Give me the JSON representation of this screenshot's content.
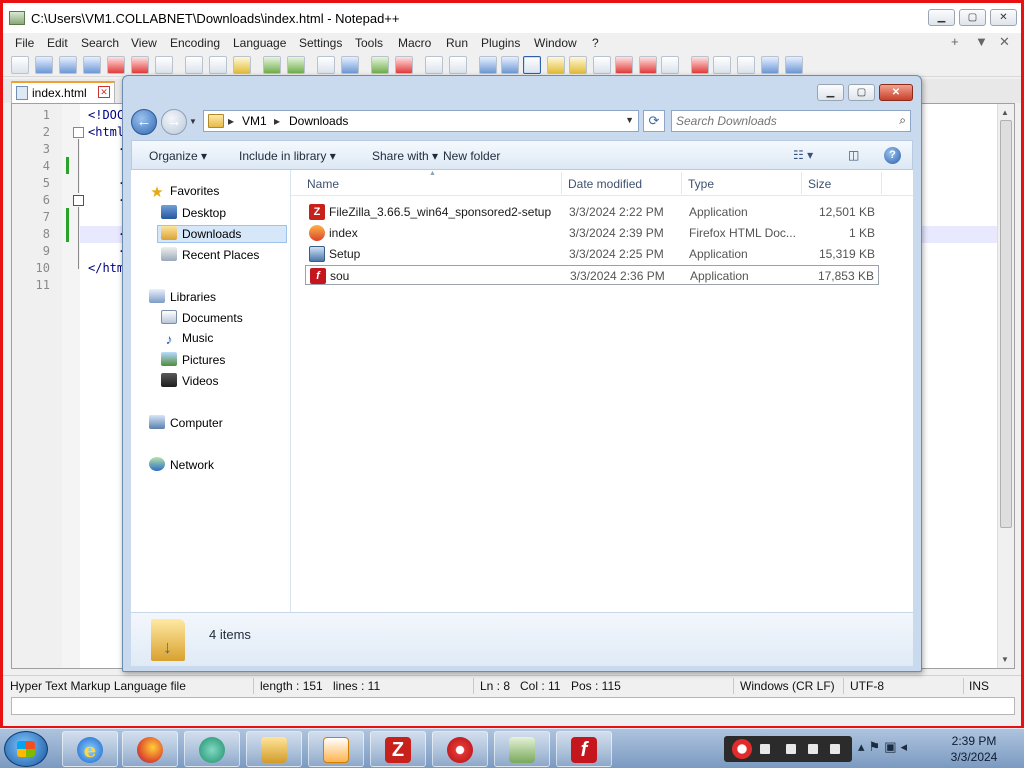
{
  "notepad": {
    "title": "C:\\Users\\VM1.COLLABNET\\Downloads\\index.html - Notepad++",
    "menu": [
      "File",
      "Edit",
      "Search",
      "View",
      "Encoding",
      "Language",
      "Settings",
      "Tools",
      "Macro",
      "Run",
      "Plugins",
      "Window",
      "?"
    ],
    "menu_right": [
      "+",
      "▼",
      "✕"
    ],
    "tab_label": "index.html",
    "line_numbers": [
      "1",
      "2",
      "3",
      "4",
      "5",
      "6",
      "7",
      "8",
      "9",
      "10",
      "11"
    ],
    "code_lines": [
      "<!DOC",
      "<html",
      "<",
      "",
      "<",
      "<",
      "",
      "<",
      "<",
      "</htm",
      ""
    ],
    "status": {
      "file_type": "Hyper Text Markup Language file",
      "length": "length : 151",
      "lines": "lines : 11",
      "ln": "Ln : 8",
      "col": "Col : 11",
      "pos": "Pos : 115",
      "eol": "Windows (CR LF)",
      "encoding": "UTF-8",
      "mode": "INS"
    }
  },
  "explorer": {
    "breadcrumb": [
      "VM1",
      "Downloads"
    ],
    "search_placeholder": "Search Downloads",
    "commands": {
      "organize": "Organize",
      "include": "Include in library",
      "share": "Share with",
      "new_folder": "New folder"
    },
    "nav": {
      "favorites": "Favorites",
      "desktop": "Desktop",
      "downloads": "Downloads",
      "recent": "Recent Places",
      "libraries": "Libraries",
      "documents": "Documents",
      "music": "Music",
      "pictures": "Pictures",
      "videos": "Videos",
      "computer": "Computer",
      "network": "Network"
    },
    "columns": {
      "name": "Name",
      "date": "Date modified",
      "type": "Type",
      "size": "Size"
    },
    "files": [
      {
        "name": "FileZilla_3.66.5_win64_sponsored2-setup",
        "date": "3/3/2024 2:22 PM",
        "type": "Application",
        "size": "12,501 KB",
        "icon": "filezilla-icon"
      },
      {
        "name": "index",
        "date": "3/3/2024 2:39 PM",
        "type": "Firefox HTML Doc...",
        "size": "1 KB",
        "icon": "firefox-html-icon"
      },
      {
        "name": "Setup",
        "date": "3/3/2024 2:25 PM",
        "type": "Application",
        "size": "15,319 KB",
        "icon": "setup-icon"
      },
      {
        "name": "sou",
        "date": "3/3/2024 2:36 PM",
        "type": "Application",
        "size": "17,853 KB",
        "icon": "flash-icon"
      }
    ],
    "item_count": "4 items"
  },
  "taskbar": {
    "time": "2:39 PM",
    "date": "3/3/2024",
    "apps": [
      "internet-explorer",
      "firefox",
      "photos",
      "file-explorer",
      "media-player",
      "filezilla",
      "screen-recorder",
      "notepad-plus-plus",
      "flash-player"
    ]
  },
  "colors": {
    "window_border": "#e81010",
    "selection": "#d7e7fa",
    "line_highlight": "#e8e8ff"
  }
}
